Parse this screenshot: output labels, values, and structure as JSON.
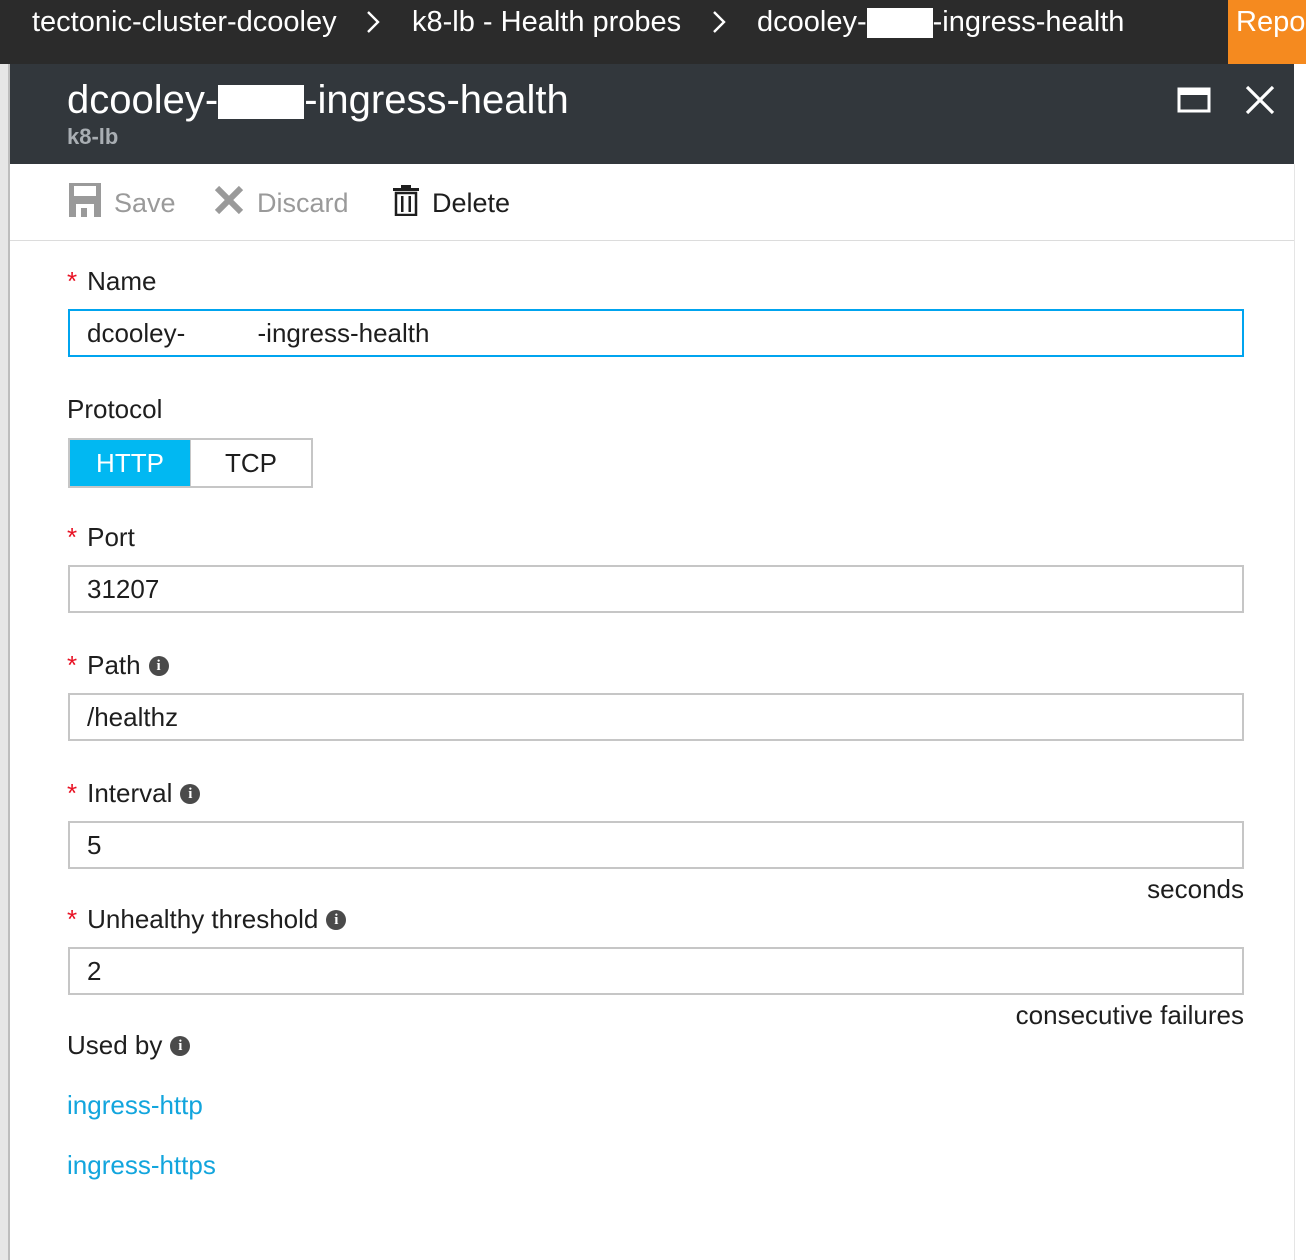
{
  "breadcrumb": {
    "items": [
      "tectonic-cluster-dcooley",
      "k8-lb - Health probes"
    ],
    "current_prefix": "dcooley-",
    "current_suffix": "-ingress-health",
    "report_label": "Repor"
  },
  "blade": {
    "title_prefix": "dcooley-",
    "title_suffix": "-ingress-health",
    "subtitle": "k8-lb"
  },
  "toolbar": {
    "save_label": "Save",
    "discard_label": "Discard",
    "delete_label": "Delete"
  },
  "form": {
    "name": {
      "label": "Name",
      "value": "dcooley-          -ingress-health"
    },
    "protocol": {
      "label": "Protocol",
      "options": [
        "HTTP",
        "TCP"
      ],
      "selected": "HTTP"
    },
    "port": {
      "label": "Port",
      "value": "31207"
    },
    "path": {
      "label": "Path",
      "value": "/healthz"
    },
    "interval": {
      "label": "Interval",
      "value": "5",
      "suffix": "seconds"
    },
    "unhealthy_threshold": {
      "label": "Unhealthy threshold",
      "value": "2",
      "suffix": "consecutive failures"
    },
    "used_by": {
      "label": "Used by",
      "links": [
        "ingress-http",
        "ingress-https"
      ]
    }
  },
  "colors": {
    "accent": "#01b8f2",
    "link": "#12a5dd",
    "required": "#e81123",
    "report": "#f58a1f",
    "header": "#32373c",
    "topbar": "#2b2b2b"
  },
  "icons": [
    "chevron-right-icon",
    "maximize-icon",
    "close-icon",
    "save-icon",
    "discard-icon",
    "delete-icon",
    "info-icon"
  ]
}
